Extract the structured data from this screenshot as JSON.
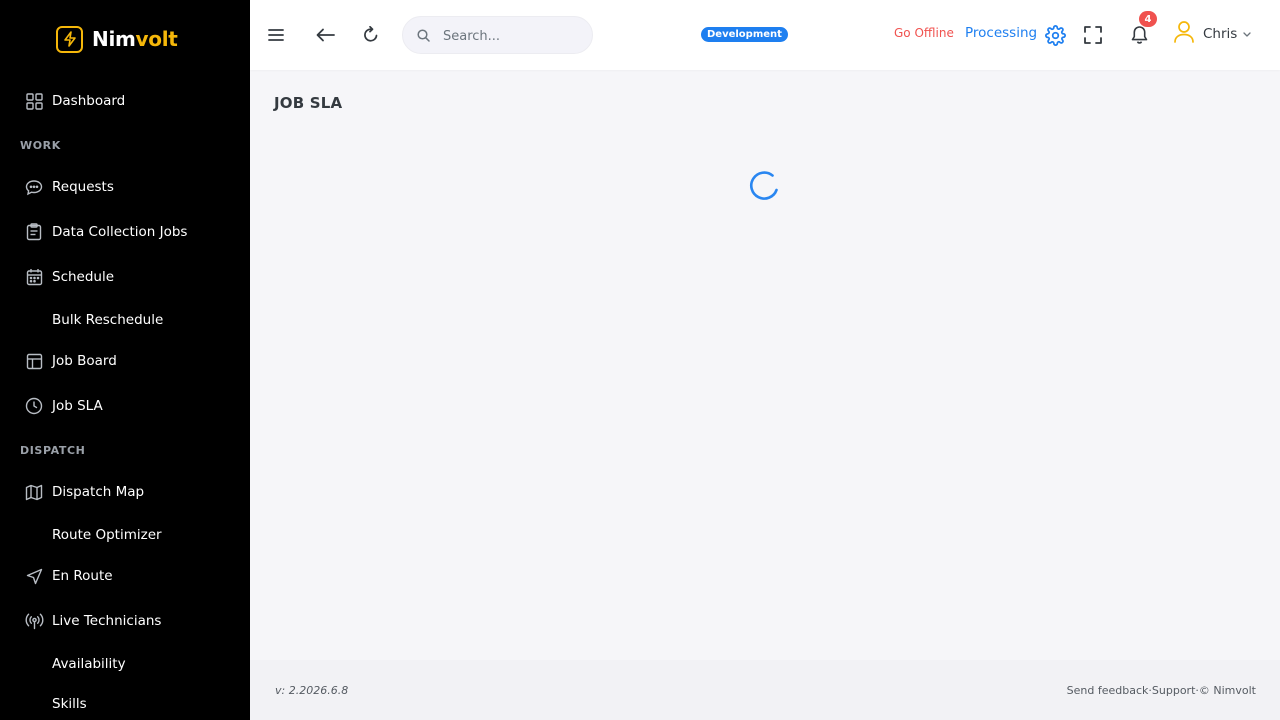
{
  "brand": {
    "name_part1": "Nim",
    "name_part2": "volt",
    "icon": "bolt-icon"
  },
  "sidebar": {
    "items": [
      {
        "label": "Dashboard",
        "icon": "grid-icon"
      },
      {
        "label": "Requests",
        "icon": "chat-icon"
      },
      {
        "label": "Data Collection Jobs",
        "icon": "clipboard-icon"
      },
      {
        "label": "Schedule",
        "icon": "calendar-icon"
      },
      {
        "label": "Bulk Reschedule",
        "icon": ""
      },
      {
        "label": "Job Board",
        "icon": "board-icon"
      },
      {
        "label": "Job SLA",
        "icon": "clock-icon"
      },
      {
        "label": "Dispatch Map",
        "icon": "map-icon"
      },
      {
        "label": "Route Optimizer",
        "icon": ""
      },
      {
        "label": "En Route",
        "icon": "navigation-icon"
      },
      {
        "label": "Live Technicians",
        "icon": "broadcast-icon"
      },
      {
        "label": "Availability",
        "icon": ""
      },
      {
        "label": "Skills",
        "icon": ""
      }
    ],
    "sections": {
      "work": "WORK",
      "dispatch": "DISPATCH"
    }
  },
  "topbar": {
    "search_placeholder": "Search...",
    "environment": "Development",
    "go_offline": "Go Offline",
    "processing": "Processing",
    "notification_count": "4",
    "user_name": "Chris"
  },
  "page": {
    "title": "JOB SLA",
    "state": "loading"
  },
  "footer": {
    "version": "v: 2.2026.6.8",
    "send_feedback": "Send feedback",
    "support": "Support",
    "copyright": "© Nimvolt",
    "separator": " · "
  },
  "colors": {
    "accent": "#1e7ff0",
    "brand": "#f5b70a",
    "danger": "#f0524f",
    "sidebar_bg": "#000000",
    "page_bg": "#f6f6f9"
  }
}
